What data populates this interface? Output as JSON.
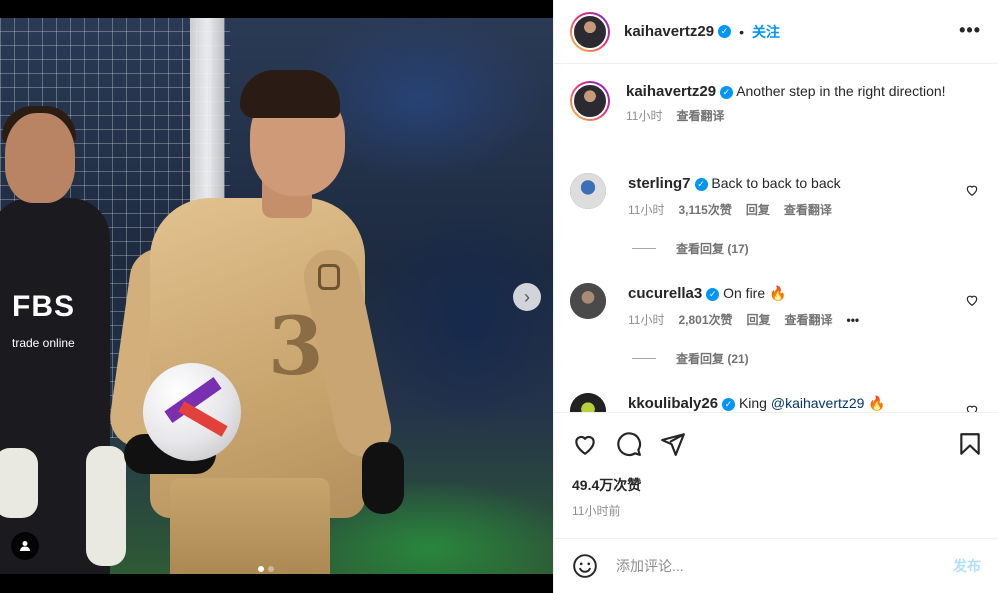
{
  "post": {
    "author": "kaihavertz29",
    "caption": "Another step in the right direction!",
    "caption_time": "11小时",
    "caption_translate": "查看翻译",
    "follow_label": "关注",
    "separator": "•",
    "more_label": "•••",
    "likes": "49.4万次赞",
    "time_ago": "11小时前",
    "photo_text": {
      "sponsor": "FBS",
      "sponsor_sub": "trade online",
      "shirt_number": "3"
    }
  },
  "comments": [
    {
      "user": "sterling7",
      "text": "Back to back to back",
      "time": "11小时",
      "likes": "3,115次赞",
      "reply": "回复",
      "translate": "查看翻译",
      "view_replies": "查看回复 (17)"
    },
    {
      "user": "cucurella3",
      "text": "On fire 🔥",
      "time": "11小时",
      "likes": "2,801次赞",
      "reply": "回复",
      "translate": "查看翻译",
      "more": "•••",
      "view_replies": "查看回复 (21)"
    },
    {
      "user": "kkoulibaly26",
      "text_prefix": "King ",
      "mention": "@kaihavertz29",
      "text_suffix": " 🔥"
    }
  ],
  "composer": {
    "placeholder": "添加评论...",
    "post_label": "发布"
  },
  "icons": {
    "verified": "verified-badge-icon",
    "next": "chevron-right-icon",
    "user_tag": "user-tag-icon",
    "like": "heart-icon",
    "comment": "comment-icon",
    "share": "share-icon",
    "save": "bookmark-icon",
    "emoji": "emoji-icon"
  },
  "colors": {
    "accent": "#0095f6",
    "text": "#262626",
    "muted": "#8e8e8e",
    "post_disabled": "#b2dffc"
  }
}
